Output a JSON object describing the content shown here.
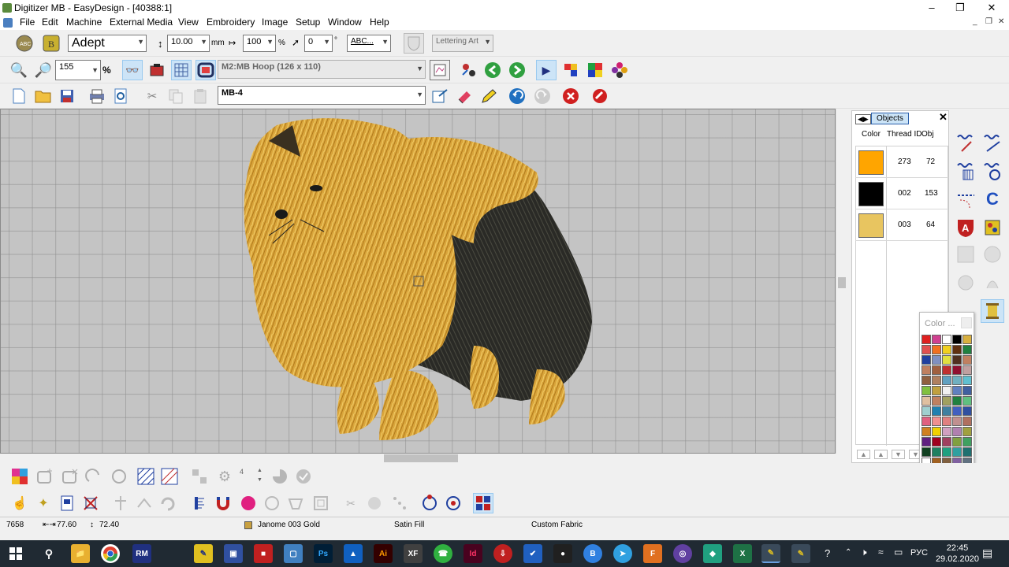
{
  "window": {
    "title": "Digitizer MB - EasyDesign - [40388:1]"
  },
  "menu": [
    "File",
    "Edit",
    "Machine",
    "External Media",
    "View",
    "Embroidery",
    "Image",
    "Setup",
    "Window",
    "Help"
  ],
  "toolbar1": {
    "font": "Adept",
    "height": "10.00",
    "height_unit": "mm",
    "width": "100",
    "width_unit": "%",
    "angle": "0",
    "angle_unit": "°",
    "abc_label": "ABC...",
    "lettering_art": "Lettering Art"
  },
  "toolbar2": {
    "zoom": "155",
    "zoom_unit": "%",
    "hoop": "M2:MB Hoop (126 x 110)"
  },
  "toolbar3": {
    "machine_format": "MB-4"
  },
  "objects_panel": {
    "tab": "Objects",
    "columns": [
      "Color",
      "Thread ID",
      "Obj"
    ],
    "rows": [
      {
        "color": "#FFA500",
        "thread_id": "273",
        "obj": "72"
      },
      {
        "color": "#000000",
        "thread_id": "002",
        "obj": "153"
      },
      {
        "color": "#E8C560",
        "thread_id": "003",
        "obj": "64"
      }
    ]
  },
  "color_popup": {
    "title": "Color ...",
    "colors": [
      "#e02020",
      "#d04090",
      "#ffffff",
      "#000000",
      "#d8b040",
      "#e05050",
      "#f07020",
      "#f0d020",
      "#603010",
      "#208040",
      "#2040a0",
      "#8090c0",
      "#e0e040",
      "#503020",
      "#c08060",
      "#c08060",
      "#a06040",
      "#c03030",
      "#901030",
      "#c0a0a0",
      "#906040",
      "#b08060",
      "#60a0c0",
      "#70b0c0",
      "#60c0d0",
      "#80c040",
      "#c0a040",
      "#f0f0f0",
      "#6080c0",
      "#4060a0",
      "#e0c0a0",
      "#c08060",
      "#a0a060",
      "#208040",
      "#60c080",
      "#a0d0d0",
      "#2080b0",
      "#4080a0",
      "#4060c0",
      "#3050a0",
      "#e06080",
      "#f09090",
      "#e08080",
      "#c09090",
      "#b07060",
      "#d08020",
      "#f0d000",
      "#d0a0c0",
      "#b080b0",
      "#a0a040",
      "#602080",
      "#a00020",
      "#a04060",
      "#80a040",
      "#40a060",
      "#104020",
      "#208060",
      "#20a080",
      "#30a0a0",
      "#207070",
      "#ffffff",
      "#a06020",
      "#806040",
      "#8060a0",
      "#607080",
      "#402010",
      "#604020",
      "#604010",
      "#402080",
      "#a02060",
      "#2070c0",
      "#80b040",
      "#c060a0",
      "#e060a0",
      "#c04060",
      "#405020",
      "#408040",
      "#c0c080",
      "#40a0c0",
      "#c08090",
      "#e08020",
      "#d06010",
      "#f0d020",
      "#ffffff",
      "#ffffff"
    ]
  },
  "status": {
    "stitches": "7658",
    "width": "77.60",
    "height": "72.40",
    "thread": "Janome 003 Gold",
    "stitch_type": "Satin Fill",
    "fabric": "Custom Fabric"
  },
  "bottom_toolbar": {
    "count": "4"
  },
  "taskbar": {
    "lang": "РУС",
    "time": "22:45",
    "date": "29.02.2020"
  }
}
